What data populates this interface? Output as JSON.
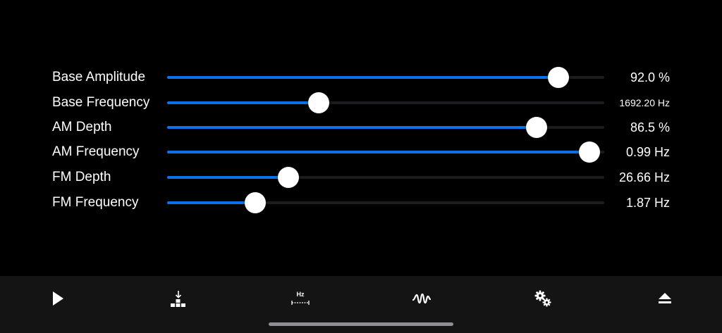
{
  "sliders": [
    {
      "label": "Base Amplitude",
      "value_text": "92.0 %",
      "fraction": 0.895
    },
    {
      "label": "Base Frequency",
      "value_text": "1692.20 Hz",
      "fraction": 0.346
    },
    {
      "label": "AM Depth",
      "value_text": "86.5 %",
      "fraction": 0.845
    },
    {
      "label": "AM Frequency",
      "value_text": "0.99 Hz",
      "fraction": 0.966
    },
    {
      "label": "FM Depth",
      "value_text": "26.66 Hz",
      "fraction": 0.277
    },
    {
      "label": "FM Frequency",
      "value_text": "1.87 Hz",
      "fraction": 0.202
    }
  ],
  "toolbar": {
    "items": [
      {
        "icon": "play-icon"
      },
      {
        "icon": "download-blocks-icon"
      },
      {
        "icon": "hz-range-icon",
        "text": "Hz"
      },
      {
        "icon": "waveform-icon"
      },
      {
        "icon": "gears-icon"
      },
      {
        "icon": "eject-icon"
      }
    ]
  },
  "colors": {
    "background": "#000000",
    "accent": "#0a72ea",
    "track": "#1c1c1e",
    "toolbar": "#141414",
    "thumb": "#ffffff"
  }
}
